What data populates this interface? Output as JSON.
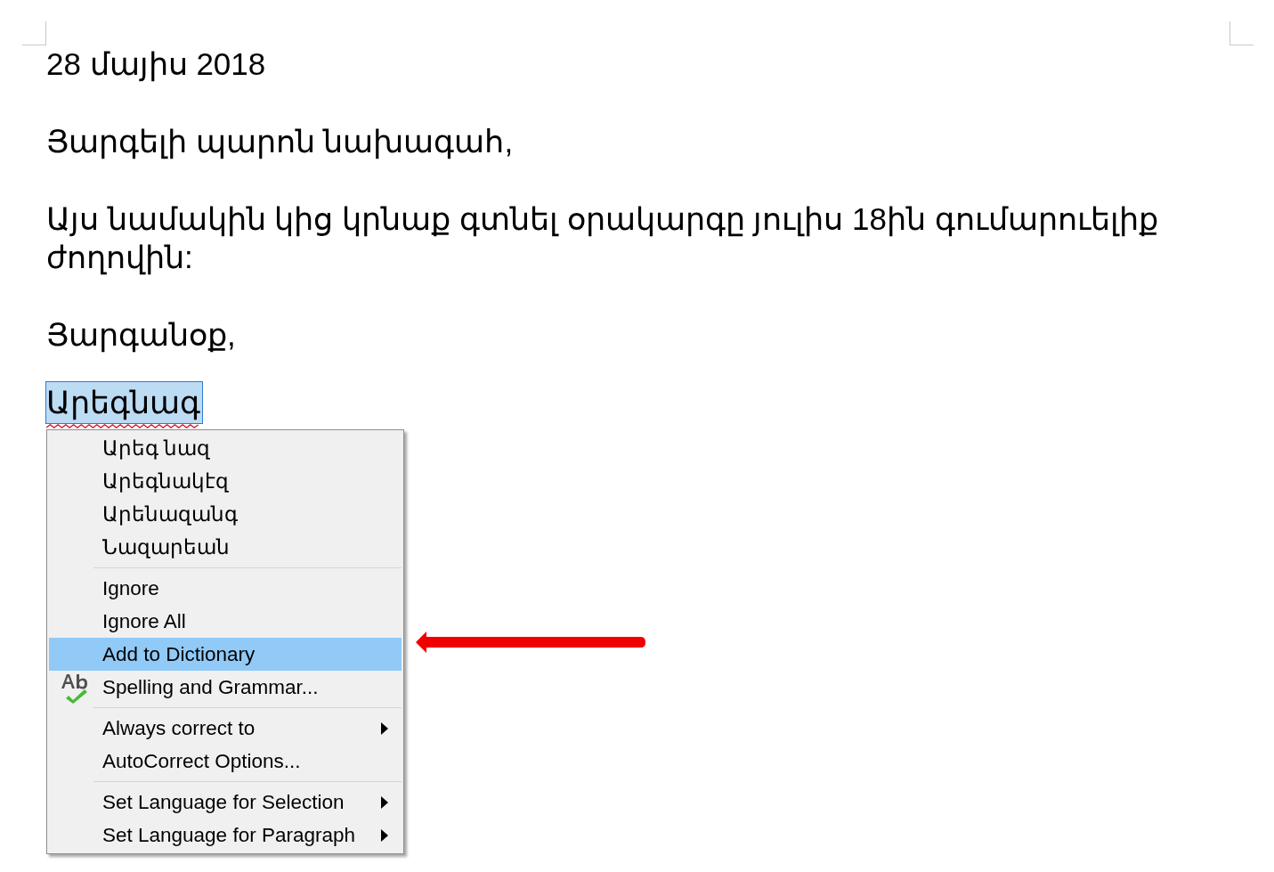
{
  "document": {
    "paragraphs": [
      {
        "text": "28 մայիս 2018"
      },
      {
        "text": "Յարգելի պարոն նախագահ,"
      },
      {
        "text": "Այս նամակին կից կրնաք գտնել օրակարգը յուլիս 18ին գումարուելիք ժողովին:"
      },
      {
        "text": "Յարգանօք,"
      }
    ],
    "misspelled_word": {
      "text": "Արեգնագ",
      "selected": true,
      "misspelled": true
    }
  },
  "context_menu": {
    "items": [
      {
        "kind": "suggestion",
        "label": "Արեգ նազ",
        "selected": false
      },
      {
        "kind": "suggestion",
        "label": "Արեգնակէզ",
        "selected": false
      },
      {
        "kind": "suggestion",
        "label": "Արենազանգ",
        "selected": false
      },
      {
        "kind": "suggestion",
        "label": "Նազարեան",
        "selected": false
      },
      {
        "kind": "separator"
      },
      {
        "kind": "command",
        "label": "Ignore",
        "selected": false,
        "submenu": false,
        "has_icon": false
      },
      {
        "kind": "command",
        "label": "Ignore All",
        "selected": false,
        "submenu": false,
        "has_icon": false
      },
      {
        "kind": "command",
        "label": "Add to Dictionary",
        "selected": true,
        "submenu": false,
        "has_icon": false
      },
      {
        "kind": "command",
        "label": "Spelling and Grammar...",
        "selected": false,
        "submenu": false,
        "has_icon": true
      },
      {
        "kind": "separator"
      },
      {
        "kind": "command",
        "label": "Always correct to",
        "selected": false,
        "submenu": true,
        "has_icon": false
      },
      {
        "kind": "command",
        "label": "AutoCorrect Options...",
        "selected": false,
        "submenu": false,
        "has_icon": false
      },
      {
        "kind": "separator"
      },
      {
        "kind": "command",
        "label": "Set Language for Selection",
        "selected": false,
        "submenu": true,
        "has_icon": false
      },
      {
        "kind": "command",
        "label": "Set Language for Paragraph",
        "selected": false,
        "submenu": true,
        "has_icon": false
      }
    ]
  }
}
